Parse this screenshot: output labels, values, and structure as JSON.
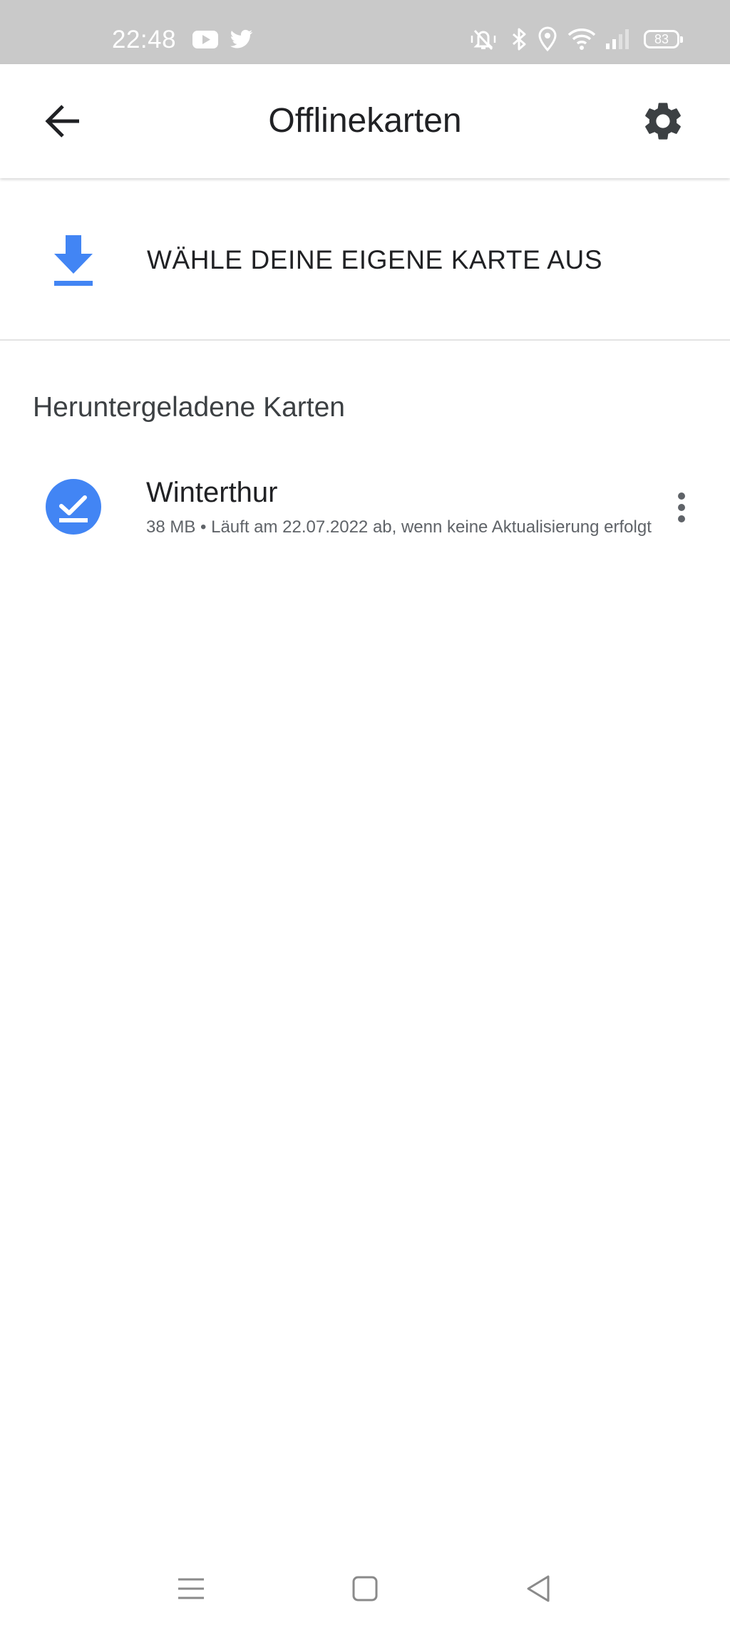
{
  "status_bar": {
    "time": "22:48",
    "battery": "83",
    "icons": [
      "youtube-icon",
      "twitter-icon",
      "vibrate-muted-icon",
      "bluetooth-icon",
      "location-icon",
      "wifi-icon",
      "signal-icon"
    ]
  },
  "app_bar": {
    "title": "Offlinekarten",
    "back_icon": "arrow-back-icon",
    "settings_icon": "gear-icon"
  },
  "select_map": {
    "label": "WÄHLE DEINE EIGENE KARTE AUS",
    "icon": "download-icon"
  },
  "downloaded": {
    "section_title": "Heruntergeladene Karten",
    "items": [
      {
        "name": "Winterthur",
        "details": "38 MB • Läuft am 22.07.2022 ab, wenn keine Aktualisierung erfolgt",
        "status_icon": "check-circle-icon",
        "menu_icon": "more-vertical-icon"
      }
    ]
  },
  "nav_bar": {
    "icons": [
      "menu-lines-icon",
      "home-square-icon",
      "back-triangle-icon"
    ]
  },
  "colors": {
    "status_bar_bg": "#c9c9c9",
    "accent_blue": "#4285f4",
    "text_primary": "#202124",
    "text_secondary": "#5f6368"
  }
}
